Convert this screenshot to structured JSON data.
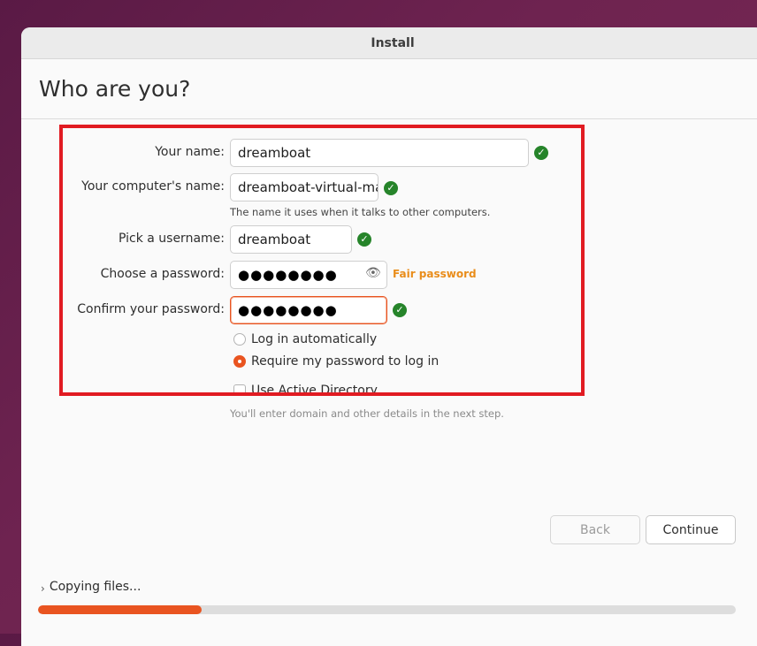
{
  "window": {
    "title": "Install"
  },
  "page": {
    "heading": "Who are you?"
  },
  "form": {
    "name_label": "Your name:",
    "name_value": "dreamboat",
    "computer_label": "Your computer's name:",
    "computer_value": "dreamboat-virtual-mac",
    "computer_hint": "The name it uses when it talks to other computers.",
    "username_label": "Pick a username:",
    "username_value": "dreamboat",
    "password_label": "Choose a password:",
    "password_value": "●●●●●●●●",
    "password_strength": "Fair password",
    "confirm_label": "Confirm your password:",
    "confirm_value": "●●●●●●●●",
    "login_auto_label": "Log in automatically",
    "login_require_label": "Require my password to log in",
    "active_directory_label": "Use Active Directory",
    "active_directory_hint": "You'll enter domain and other details in the next step.",
    "selected_login": "require"
  },
  "buttons": {
    "back": "Back",
    "continue": "Continue"
  },
  "progress": {
    "label": "Copying files...",
    "value": 0.235
  },
  "colors": {
    "accent": "#e95420",
    "ok": "#26842a",
    "warning": "#e98d1a",
    "highlight": "#e11b22"
  }
}
